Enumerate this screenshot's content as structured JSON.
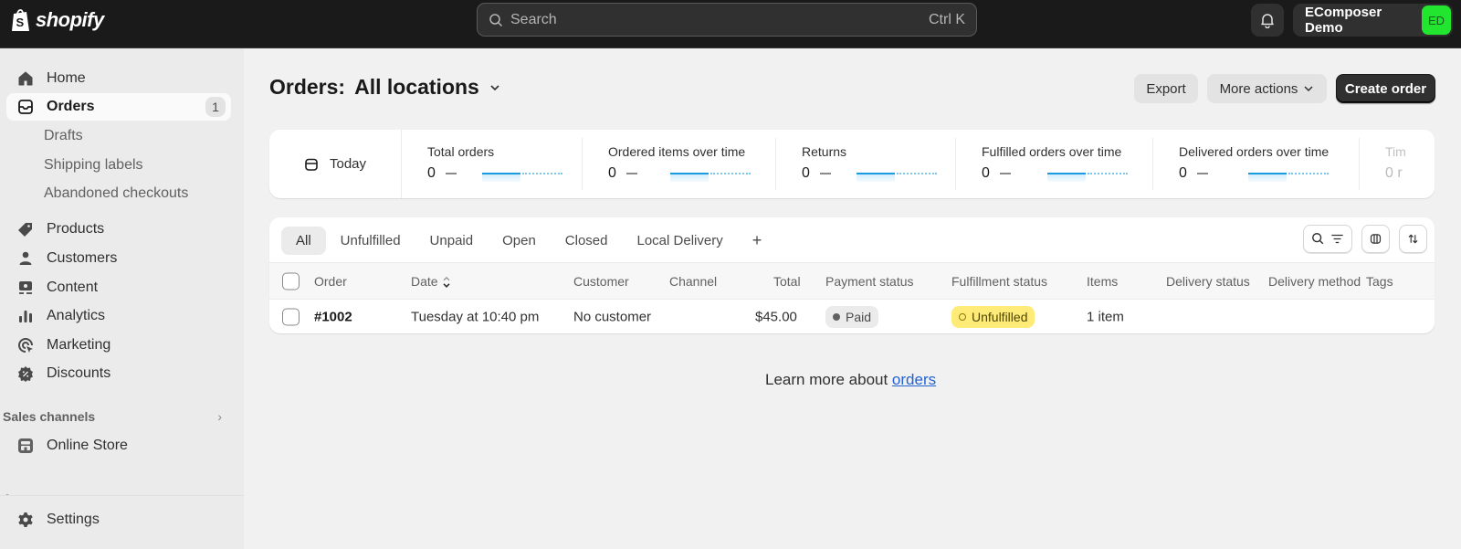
{
  "topbar": {
    "brand": "shopify",
    "search_placeholder": "Search",
    "search_shortcut": "Ctrl K",
    "account_name": "EComposer Demo",
    "account_initials": "ED",
    "avatar_color": "#21e52f"
  },
  "sidebar": {
    "items": [
      {
        "label": "Home",
        "icon": "home-icon"
      },
      {
        "label": "Orders",
        "icon": "inbox-icon",
        "badge": "1",
        "active": true
      },
      {
        "label": "Products",
        "icon": "tag-icon"
      },
      {
        "label": "Customers",
        "icon": "person-icon"
      },
      {
        "label": "Content",
        "icon": "content-icon"
      },
      {
        "label": "Analytics",
        "icon": "bar-chart-icon"
      },
      {
        "label": "Marketing",
        "icon": "target-icon"
      },
      {
        "label": "Discounts",
        "icon": "discount-icon"
      }
    ],
    "orders_subitems": [
      "Drafts",
      "Shipping labels",
      "Abandoned checkouts"
    ],
    "sales_channels_title": "Sales channels",
    "sales_channels": [
      {
        "label": "Online Store",
        "icon": "store-icon"
      }
    ],
    "apps_title": "Apps",
    "settings_label": "Settings"
  },
  "page": {
    "title_prefix": "Orders:",
    "title_location": "All locations",
    "buttons": {
      "export": "Export",
      "more_actions": "More actions",
      "create_order": "Create order"
    }
  },
  "metrics": {
    "date_range": "Today",
    "cards": [
      {
        "label": "Total orders",
        "value": "0"
      },
      {
        "label": "Ordered items over time",
        "value": "0"
      },
      {
        "label": "Returns",
        "value": "0"
      },
      {
        "label": "Fulfilled orders over time",
        "value": "0"
      },
      {
        "label": "Delivered orders over time",
        "value": "0"
      },
      {
        "label": "Tim",
        "value": "0 r"
      }
    ]
  },
  "orders": {
    "tabs": [
      "All",
      "Unfulfilled",
      "Unpaid",
      "Open",
      "Closed",
      "Local Delivery",
      "+"
    ],
    "active_tab": "All",
    "columns": [
      "Order",
      "Date",
      "Customer",
      "Channel",
      "Total",
      "Payment status",
      "Fulfillment status",
      "Items",
      "Delivery status",
      "Delivery method",
      "Tags"
    ],
    "rows": [
      {
        "order": "#1002",
        "date": "Tuesday at 10:40 pm",
        "customer": "No customer",
        "channel": "",
        "total": "$45.00",
        "payment_status": "Paid",
        "fulfillment_status": "Unfulfilled",
        "items": "1 item",
        "delivery_status": "",
        "delivery_method": "",
        "tags": ""
      }
    ]
  },
  "footer": {
    "learn_text": "Learn more about ",
    "learn_link": "orders"
  },
  "colors": {
    "link": "#2463d1",
    "unfulfilled_badge": "#ffeb78",
    "primary_button": "#303030"
  }
}
